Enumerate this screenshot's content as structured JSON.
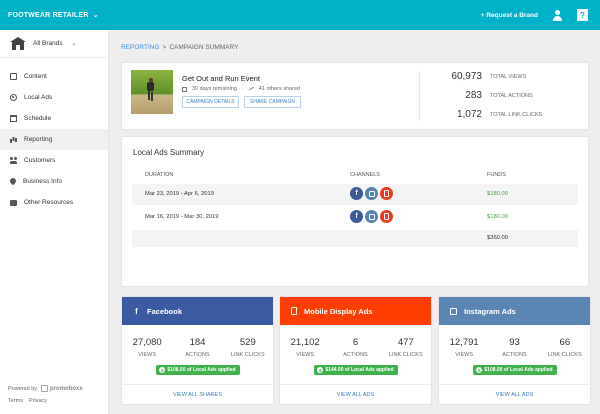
{
  "topbar": {
    "brand": "FOOTWEAR RETAILER",
    "request": "+ Request a Brand",
    "help_glyph": "?"
  },
  "sidebar": {
    "brands_label": "All Brands",
    "items": [
      {
        "label": "Content",
        "icon": "content-icon"
      },
      {
        "label": "Local Ads",
        "icon": "local-ads-icon"
      },
      {
        "label": "Schedule",
        "icon": "schedule-icon"
      },
      {
        "label": "Reporting",
        "icon": "reporting-icon",
        "active": true
      },
      {
        "label": "Customers",
        "icon": "customers-icon"
      },
      {
        "label": "Business Info",
        "icon": "location-icon"
      },
      {
        "label": "Other Resources",
        "icon": "briefcase-icon"
      }
    ],
    "powered_by": "Powered by",
    "powered_brand": "promoboxx",
    "terms": "Terms",
    "privacy": "Privacy"
  },
  "breadcrumb": {
    "root": "REPORTING",
    "separator": ">",
    "current": "CAMPAIGN SUMMARY"
  },
  "campaign": {
    "title": "Get Out and Run Event",
    "days_remaining": "30 days remaining",
    "dot": "·",
    "shared": "41 others shared",
    "details_btn": "CAMPAIGN DETAILS",
    "share_btn": "SHARE CAMPAIGN",
    "stats": [
      {
        "value": "60,973",
        "label": "TOTAL VIEWS"
      },
      {
        "value": "283",
        "label": "TOTAL ACTIONS"
      },
      {
        "value": "1,072",
        "label": "TOTAL LINK CLICKS"
      }
    ]
  },
  "summary": {
    "title": "Local Ads Summary",
    "headers": {
      "duration": "DURATION",
      "channels": "CHANNELS",
      "funds": "FUNDS"
    },
    "rows": [
      {
        "dates": "Mar 23, 2019 - Apr 6, 2019",
        "funds": "$180.00"
      },
      {
        "dates": "Mar 16, 2019 - Mar 30, 2019",
        "funds": "$180.00"
      }
    ],
    "total": "$360.00",
    "channel_glyphs": {
      "facebook": "f"
    }
  },
  "channels": [
    {
      "name": "Facebook",
      "icon_glyph": "f",
      "views": "27,080",
      "actions": "184",
      "clicks": "529",
      "applied": "$108.00 of Local Ads applied",
      "footer": "VIEW ALL SHARES"
    },
    {
      "name": "Mobile Display Ads",
      "views": "21,102",
      "actions": "6",
      "clicks": "477",
      "applied": "$144.00 of Local Ads applied",
      "footer": "VIEW ALL ADS"
    },
    {
      "name": "Instagram Ads",
      "views": "12,791",
      "actions": "93",
      "clicks": "66",
      "applied": "$108.00 of Local Ads applied",
      "footer": "VIEW ALL ADS"
    }
  ],
  "labels": {
    "views": "VIEWS",
    "actions": "ACTIONS",
    "clicks": "LINK CLICKS",
    "dollar": "$"
  },
  "colors": {
    "topbar": "#00b1c7",
    "facebook": "#3b5aa2",
    "mobile": "#ff3d00",
    "instagram": "#5b86b3",
    "funds_green": "#3fa447",
    "link_blue": "#3b7bc6"
  }
}
